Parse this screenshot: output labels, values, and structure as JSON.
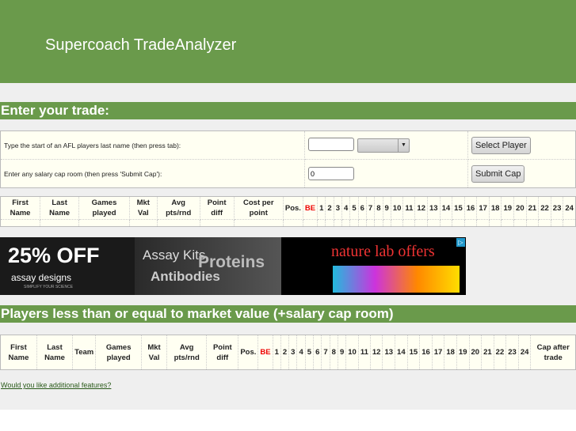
{
  "header": {
    "title": "Supercoach TradeAnalyzer"
  },
  "trade": {
    "title": "Enter your trade:",
    "name_label": "Type the start of an AFL players last name (then press tab):",
    "name_value": "",
    "select_button": "Select Player",
    "cap_label": "Enter any salary cap room (then press 'Submit Cap'):",
    "cap_value": "0",
    "submit_button": "Submit Cap"
  },
  "trade_table": {
    "columns": [
      "First Name",
      "Last Name",
      "Games played",
      "Mkt Val",
      "Avg pts/rnd",
      "Point diff",
      "Cost per point",
      "Pos.",
      "BE",
      "1",
      "2",
      "3",
      "4",
      "5",
      "6",
      "7",
      "8",
      "9",
      "10",
      "11",
      "12",
      "13",
      "14",
      "15",
      "16",
      "17",
      "18",
      "19",
      "20",
      "21",
      "22",
      "23",
      "24"
    ]
  },
  "ad": {
    "headline": "25% OFF",
    "brand": "assay designs",
    "tagline": "SIMPLIFY YOUR SCIENCE",
    "products": [
      "Assay Kits",
      "Proteins",
      "Antibodies"
    ],
    "offer": "nature lab offers"
  },
  "results": {
    "title": "Players less than or equal to market value (+salary cap room)",
    "columns": [
      "First Name",
      "Last Name",
      "Team",
      "Games played",
      "Mkt Val",
      "Avg pts/rnd",
      "Point diff",
      "Pos.",
      "BE",
      "1",
      "2",
      "3",
      "4",
      "5",
      "6",
      "7",
      "8",
      "9",
      "10",
      "11",
      "12",
      "13",
      "14",
      "15",
      "16",
      "17",
      "18",
      "19",
      "20",
      "21",
      "22",
      "23",
      "24",
      "Cap after trade"
    ]
  },
  "footer": {
    "link": "Would you like additional features?"
  },
  "colors": {
    "brand_green": "#6a9a4b",
    "be_red": "#e00000"
  }
}
